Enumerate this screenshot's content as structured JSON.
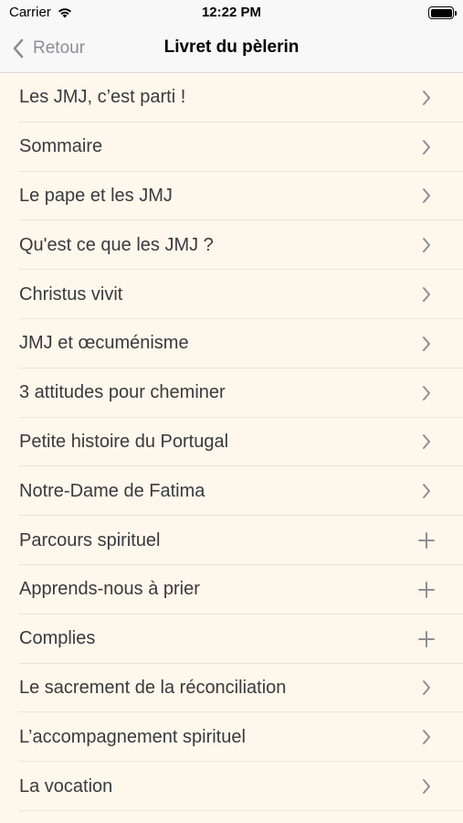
{
  "status_bar": {
    "carrier": "Carrier",
    "time": "12:22 PM"
  },
  "nav": {
    "back_label": "Retour",
    "title": "Livret du pèlerin"
  },
  "colors": {
    "background": "#fdf7ec",
    "bar": "#f8f8f8",
    "chevron": "#8e8e93"
  },
  "items": [
    {
      "label": "Les JMJ, c’est parti !",
      "accessory": "chevron-right-icon"
    },
    {
      "label": "Sommaire",
      "accessory": "chevron-right-icon"
    },
    {
      "label": "Le pape et les JMJ",
      "accessory": "chevron-right-icon"
    },
    {
      "label": "Qu'est ce que les JMJ ?",
      "accessory": "chevron-right-icon"
    },
    {
      "label": "Christus vivit",
      "accessory": "chevron-right-icon"
    },
    {
      "label": "JMJ et œcuménisme",
      "accessory": "chevron-right-icon"
    },
    {
      "label": "3 attitudes pour cheminer",
      "accessory": "chevron-right-icon"
    },
    {
      "label": "Petite histoire du Portugal",
      "accessory": "chevron-right-icon"
    },
    {
      "label": "Notre-Dame de Fatima",
      "accessory": "chevron-right-icon"
    },
    {
      "label": "Parcours spirituel",
      "accessory": "plus-icon"
    },
    {
      "label": "Apprends-nous à prier",
      "accessory": "plus-icon"
    },
    {
      "label": "Complies",
      "accessory": "plus-icon"
    },
    {
      "label": "Le sacrement de la réconciliation",
      "accessory": "chevron-right-icon"
    },
    {
      "label": "L’accompagnement spirituel",
      "accessory": "chevron-right-icon"
    },
    {
      "label": "La vocation",
      "accessory": "chevron-right-icon"
    }
  ]
}
